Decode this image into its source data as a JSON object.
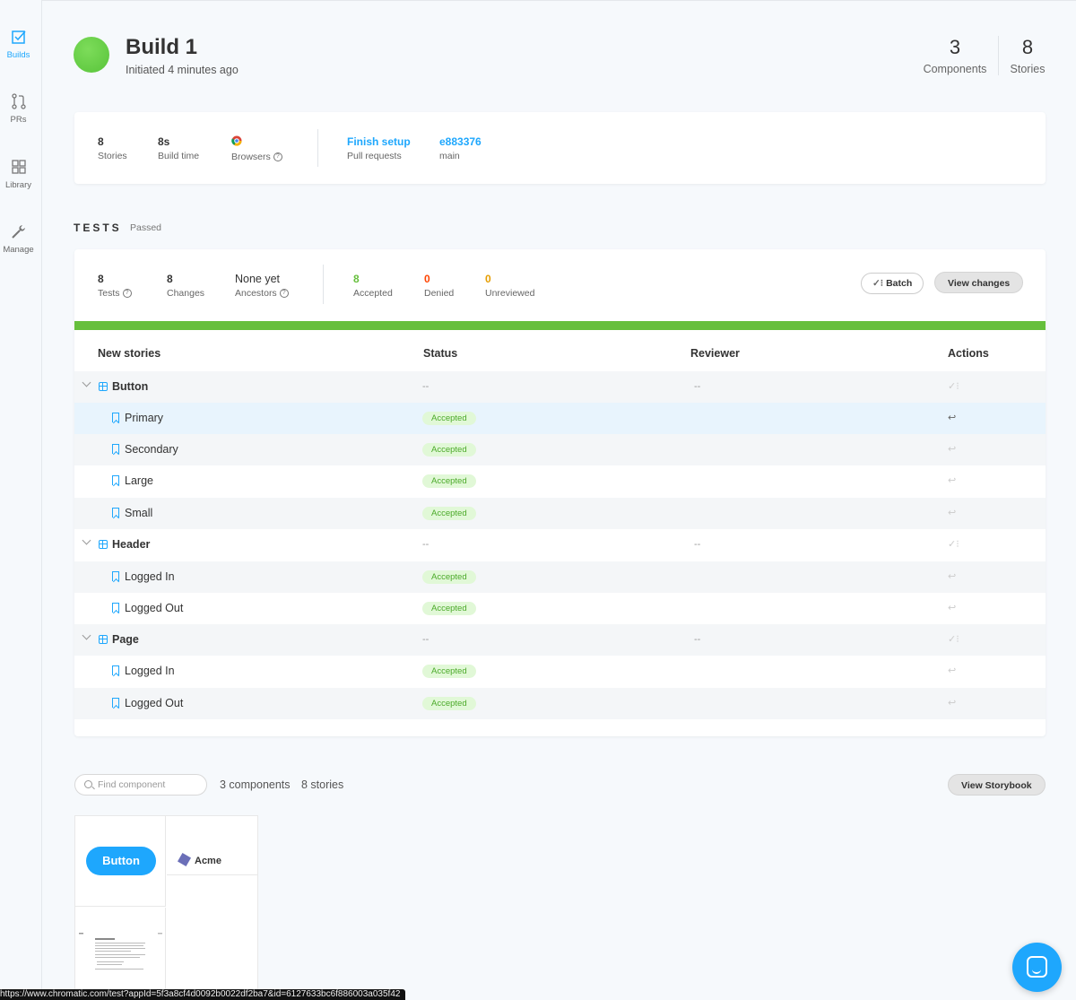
{
  "sidebar": {
    "items": [
      {
        "label": "Builds",
        "icon": "checkbox-icon",
        "active": true
      },
      {
        "label": "PRs",
        "icon": "pull-request-icon"
      },
      {
        "label": "Library",
        "icon": "grid-icon"
      },
      {
        "label": "Manage",
        "icon": "wrench-icon"
      }
    ]
  },
  "header": {
    "title": "Build 1",
    "subtitle": "Initiated 4 minutes ago",
    "status_color": "#66bf3c",
    "stats": [
      {
        "value": "3",
        "label": "Components"
      },
      {
        "value": "8",
        "label": "Stories"
      }
    ]
  },
  "build_meta": {
    "stories": {
      "value": "8",
      "label": "Stories"
    },
    "build_time": {
      "value": "8s",
      "label": "Build time"
    },
    "browsers": {
      "label": "Browsers",
      "icon": "chrome-icon"
    },
    "pull_requests": {
      "value": "Finish setup",
      "label": "Pull requests"
    },
    "commit": {
      "value": "e883376",
      "label": "main"
    }
  },
  "tests": {
    "title": "TESTS",
    "status": "Passed",
    "tests": {
      "value": "8",
      "label": "Tests"
    },
    "changes": {
      "value": "8",
      "label": "Changes"
    },
    "ancestors": {
      "value": "None yet",
      "label": "Ancestors"
    },
    "accepted": {
      "value": "8",
      "label": "Accepted",
      "color": "#66bf3c"
    },
    "denied": {
      "value": "0",
      "label": "Denied",
      "color": "#ff4400"
    },
    "unreviewed": {
      "value": "0",
      "label": "Unreviewed",
      "color": "#e69d00"
    },
    "batch_label": "Batch",
    "view_changes_label": "View changes",
    "progress_accepted": 1.0
  },
  "table": {
    "headers": [
      "New stories",
      "Status",
      "Reviewer",
      "Actions"
    ],
    "rows": [
      {
        "type": "component",
        "name": "Button",
        "status": "--",
        "reviewer": "--"
      },
      {
        "type": "story",
        "name": "Primary",
        "status": "Accepted",
        "selected": true
      },
      {
        "type": "story",
        "name": "Secondary",
        "status": "Accepted"
      },
      {
        "type": "story",
        "name": "Large",
        "status": "Accepted"
      },
      {
        "type": "story",
        "name": "Small",
        "status": "Accepted"
      },
      {
        "type": "component",
        "name": "Header",
        "status": "--",
        "reviewer": "--"
      },
      {
        "type": "story",
        "name": "Logged In",
        "status": "Accepted"
      },
      {
        "type": "story",
        "name": "Logged Out",
        "status": "Accepted"
      },
      {
        "type": "component",
        "name": "Page",
        "status": "--",
        "reviewer": "--"
      },
      {
        "type": "story",
        "name": "Logged In",
        "status": "Accepted"
      },
      {
        "type": "story",
        "name": "Logged Out",
        "status": "Accepted"
      }
    ]
  },
  "library": {
    "search_placeholder": "Find component",
    "components_count": "3 components",
    "stories_count": "8 stories",
    "view_storybook_label": "View Storybook",
    "thumb_button_label": "Button",
    "thumb_header_label": "Acme"
  },
  "status_url": "https://www.chromatic.com/test?appId=5f3a8cf4d0092b0022df2ba7&id=6127633bc6f886003a035f42"
}
